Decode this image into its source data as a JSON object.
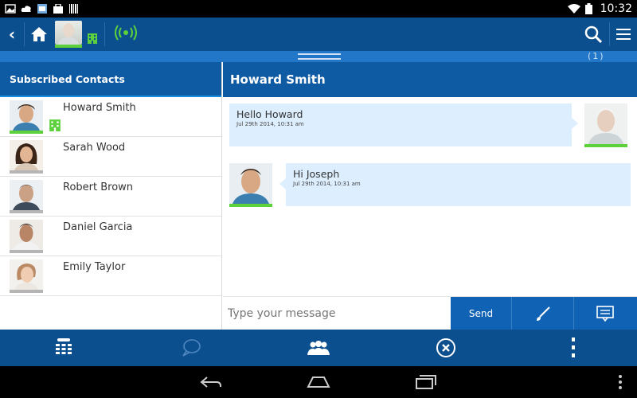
{
  "status_bar": {
    "time": "10:32"
  },
  "top_bar": {
    "back_label": "‹",
    "unread_count": "(1)"
  },
  "contacts_panel": {
    "title": "Subscribed Contacts",
    "contacts": [
      {
        "name": "Howard Smith",
        "presence": "online",
        "has_building": true
      },
      {
        "name": "Sarah Wood",
        "presence": "offline",
        "has_building": false
      },
      {
        "name": "Robert Brown",
        "presence": "offline",
        "has_building": false
      },
      {
        "name": "Daniel Garcia",
        "presence": "offline",
        "has_building": false
      },
      {
        "name": "Emily Taylor",
        "presence": "offline",
        "has_building": false
      }
    ]
  },
  "chat": {
    "title": "Howard Smith",
    "messages": [
      {
        "text": "Hello Howard",
        "timestamp": "Jul 29th 2014, 10:31 am",
        "sender": "self"
      },
      {
        "text": "Hi Joseph",
        "timestamp": "Jul 29th 2014, 10:31 am",
        "sender": "contact"
      }
    ],
    "composer": {
      "placeholder": "Type your message",
      "send_label": "Send"
    }
  },
  "colors": {
    "primary": "#0b4f8f",
    "header": "#0e5aa3",
    "accent": "#2277c8",
    "bubble": "#ddeeff",
    "presence_online": "#5cd13c",
    "presence_offline": "#b5b5b5"
  },
  "icons": [
    "wifi-icon",
    "battery-icon",
    "home-icon",
    "building-icon",
    "signal-icon",
    "search-icon",
    "menu-icon",
    "dialpad-icon",
    "chat-bubble-icon",
    "contacts-icon",
    "close-circle-icon",
    "overflow-icon",
    "brush-icon",
    "message-icon",
    "nav-back-icon",
    "nav-home-icon",
    "nav-recents-icon"
  ]
}
